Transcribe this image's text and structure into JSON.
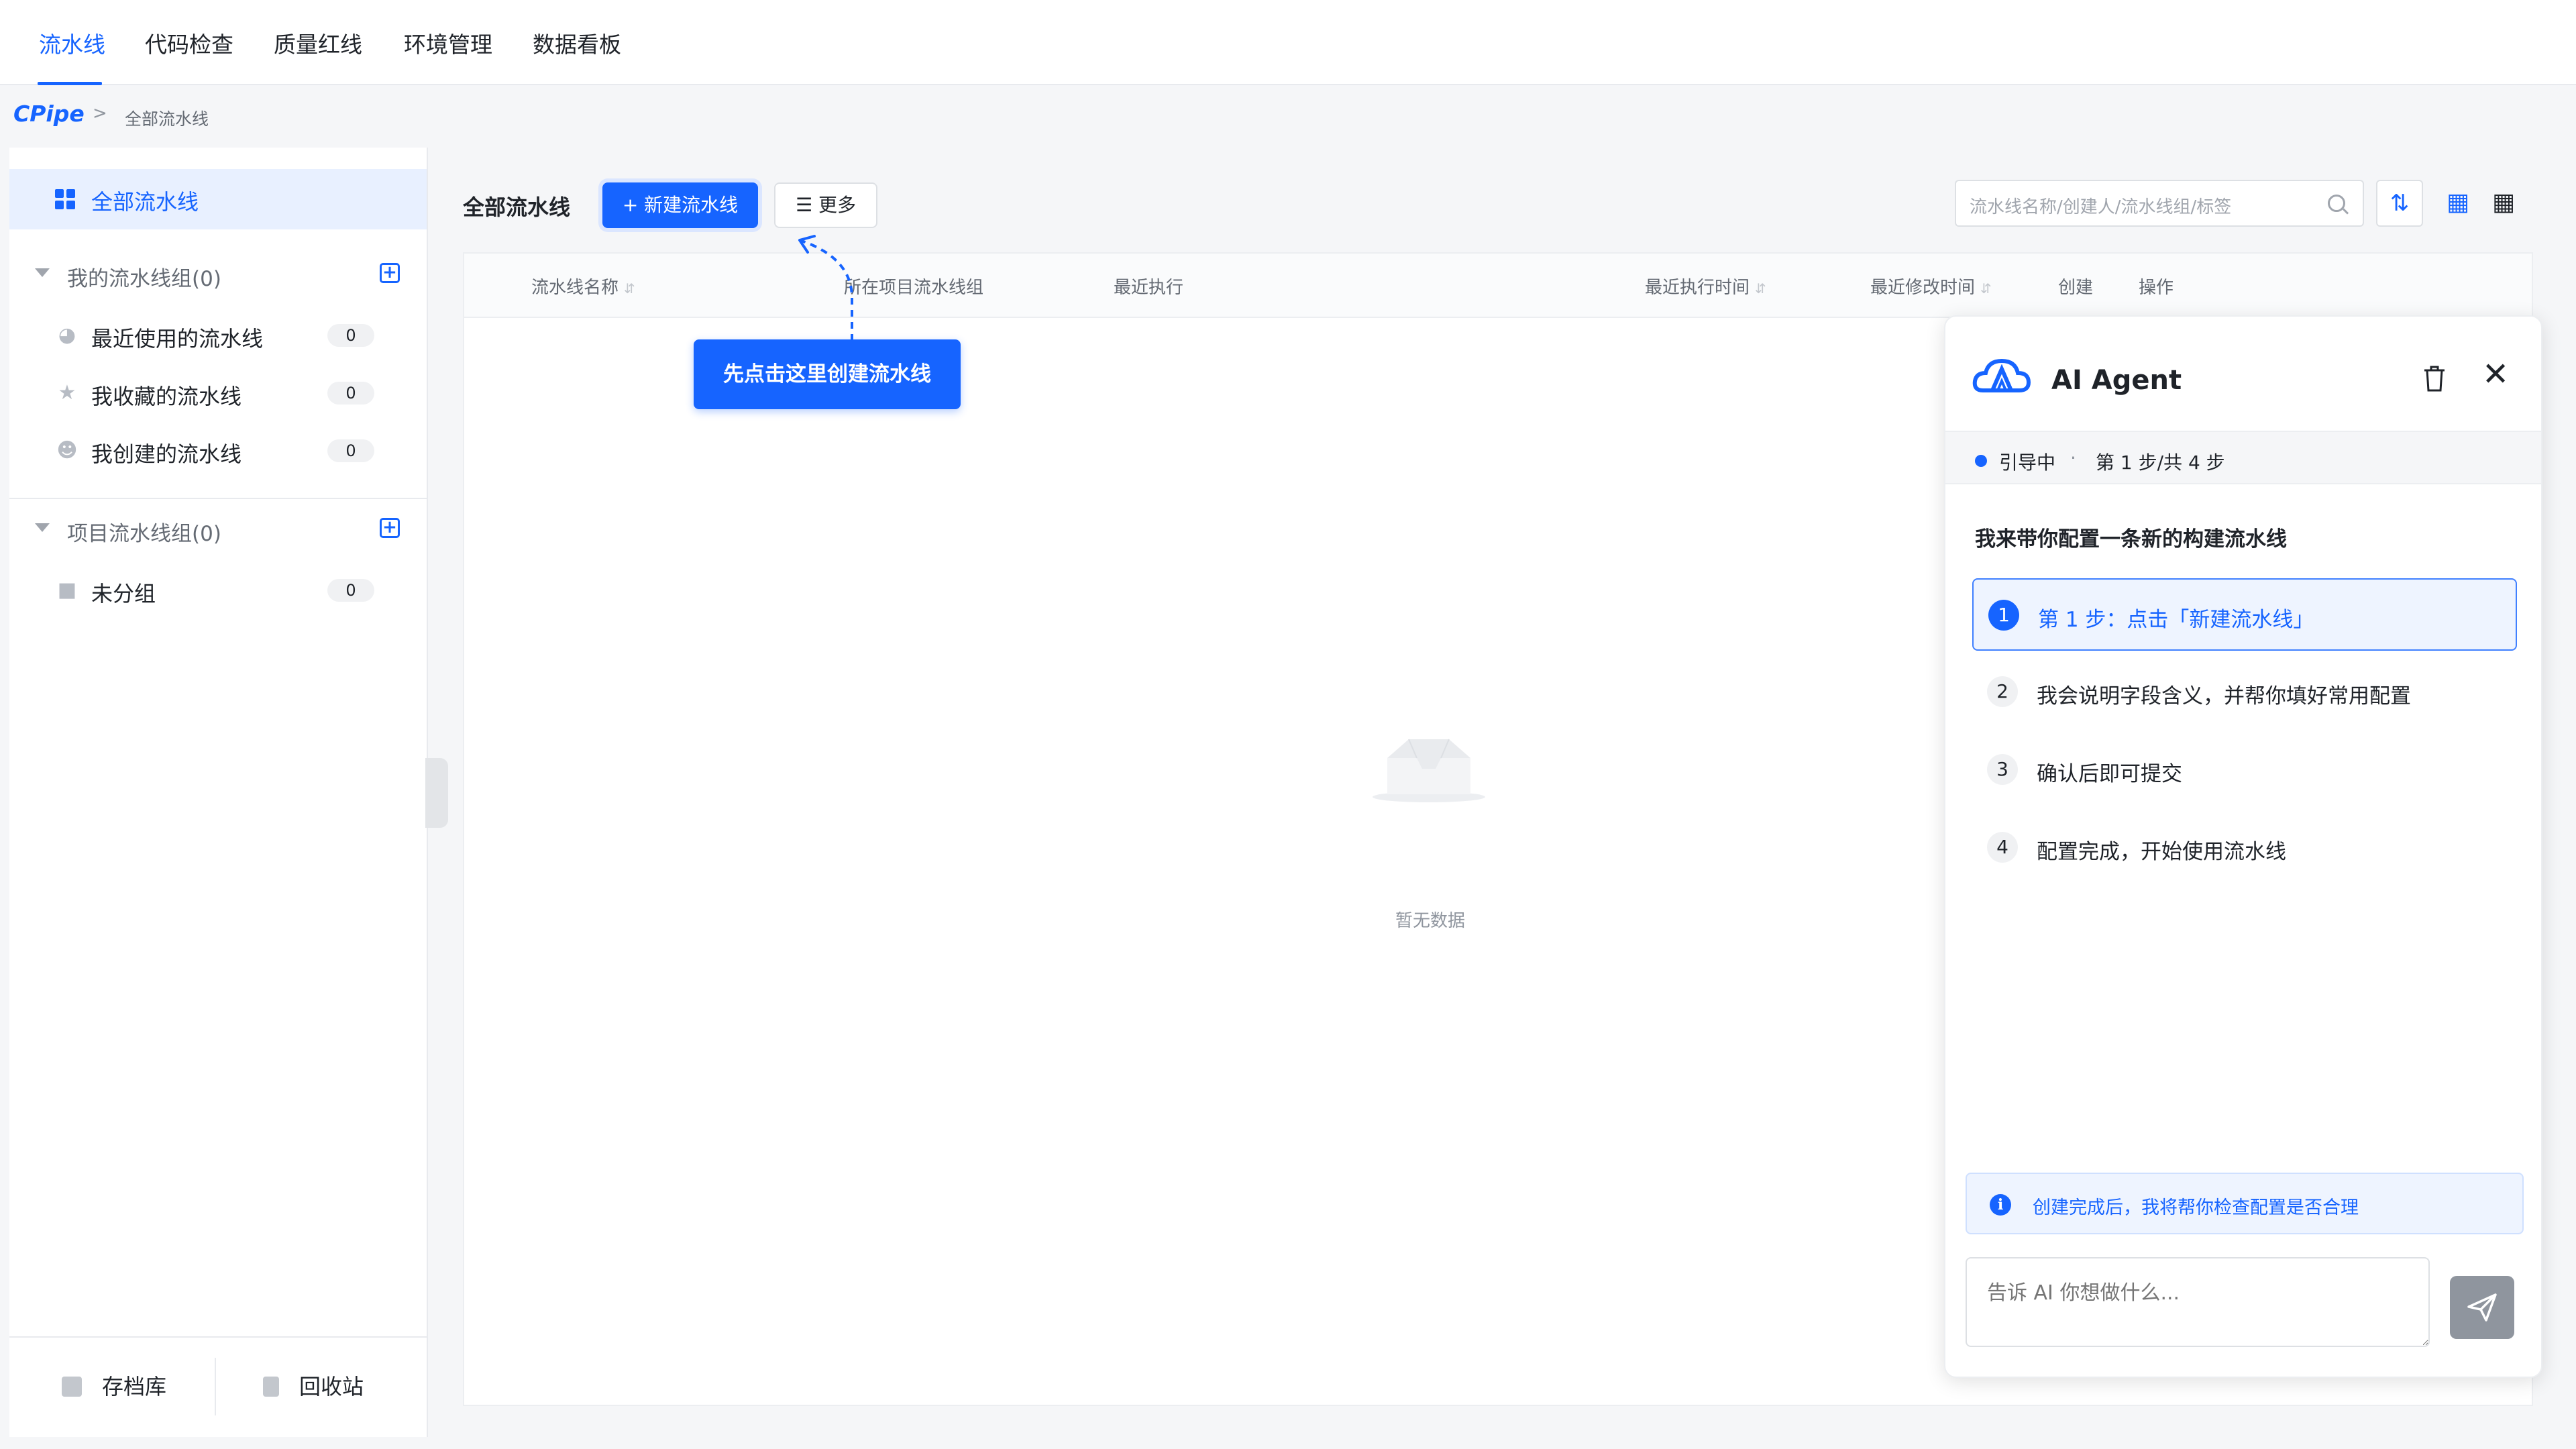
{
  "nav": {
    "tabs": [
      {
        "label": "流水线",
        "active": true
      },
      {
        "label": "代码检查"
      },
      {
        "label": "质量红线"
      },
      {
        "label": "环境管理"
      },
      {
        "label": "数据看板"
      }
    ]
  },
  "breadcrumb": {
    "logo": "CPipe",
    "separator": ">",
    "current": "全部流水线"
  },
  "sidebar": {
    "all_label": "全部流水线",
    "my_group": {
      "label": "我的流水线组(0)",
      "items": [
        {
          "label": "最近使用的流水线",
          "count": "0",
          "icon": "clock-icon"
        },
        {
          "label": "我收藏的流水线",
          "count": "0",
          "icon": "star-icon"
        },
        {
          "label": "我创建的流水线",
          "count": "0",
          "icon": "user-icon"
        }
      ]
    },
    "project_group": {
      "label": "项目流水线组(0)",
      "items": [
        {
          "label": "未分组",
          "count": "0",
          "icon": "folder-icon"
        }
      ]
    },
    "footer": {
      "archive": "存档库",
      "recycle": "回收站"
    }
  },
  "main": {
    "title": "全部流水线",
    "new_button": "+ 新建流水线",
    "more_button": "☰ 更多",
    "search_placeholder": "流水线名称/创建人/流水线组/标签",
    "columns": {
      "name": "流水线名称",
      "group": "所在项目流水线组",
      "last_exec": "最近执行",
      "last_exec_time": "最近执行时间",
      "last_modified": "最近修改时间",
      "created": "创建",
      "actions": "操作"
    },
    "empty_text": "暂无数据",
    "callout": "先点击这里创建流水线"
  },
  "ai": {
    "title": "AI Agent",
    "status": "引导中",
    "status_sep": "·",
    "progress": "第 1 步/共 4 步",
    "intro": "我来带你配置一条新的构建流水线",
    "steps": [
      {
        "num": "1",
        "text": "第 1 步：点击「新建流水线」",
        "active": true
      },
      {
        "num": "2",
        "text": "我会说明字段含义，并帮你填好常用配置"
      },
      {
        "num": "3",
        "text": "确认后即可提交"
      },
      {
        "num": "4",
        "text": "配置完成，开始使用流水线"
      }
    ],
    "tip": "创建完成后，我将帮你检查配置是否合理",
    "input_placeholder": "告诉 AI 你想做什么..."
  },
  "colors": {
    "accent": "#1664ff",
    "text": "#1f2329",
    "muted": "#646a73"
  }
}
